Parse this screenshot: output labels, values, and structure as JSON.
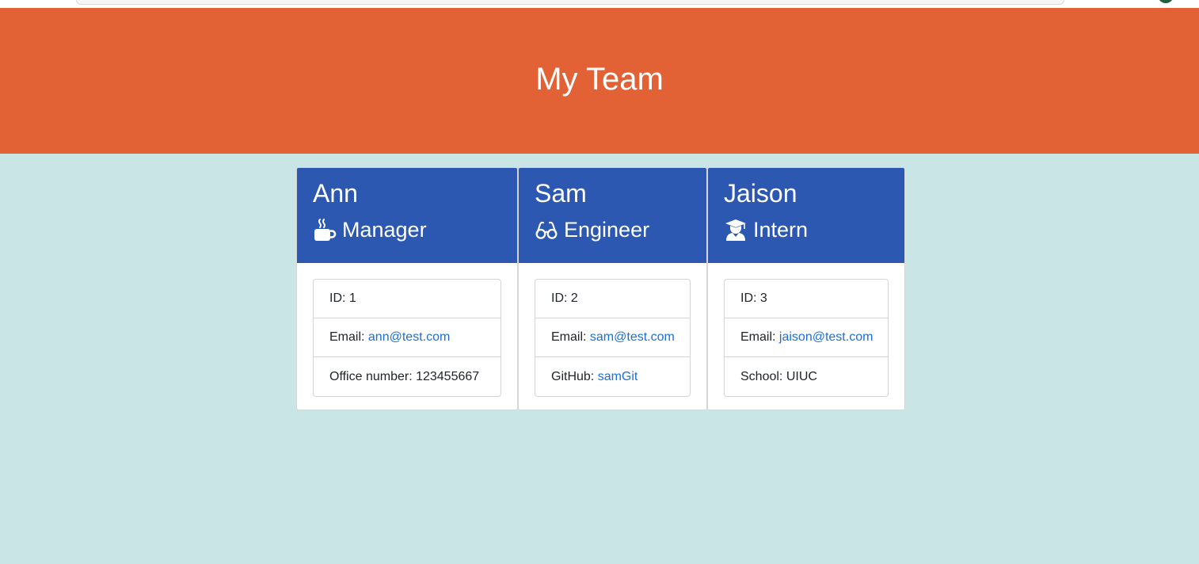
{
  "page_title": "My Team",
  "colors": {
    "header_bg": "#e26236",
    "card_header_bg": "#2c58b2",
    "page_bg": "#cae5e5",
    "link": "#1a6fe0"
  },
  "employees": [
    {
      "name": "Ann",
      "role": "Manager",
      "role_icon": "coffee-mug-icon",
      "id_label": "ID: 1",
      "email_label": "Email: ",
      "email": "ann@test.com",
      "extra_label": "Office number: 123455667",
      "extra_link": ""
    },
    {
      "name": "Sam",
      "role": "Engineer",
      "role_icon": "glasses-icon",
      "id_label": "ID: 2",
      "email_label": "Email: ",
      "email": "sam@test.com",
      "extra_label": "GitHub: ",
      "extra_link": "samGit"
    },
    {
      "name": "Jaison",
      "role": "Intern",
      "role_icon": "graduate-icon",
      "id_label": "ID: 3",
      "email_label": "Email: ",
      "email": "jaison@test.com",
      "extra_label": "School: UIUC",
      "extra_link": ""
    }
  ]
}
